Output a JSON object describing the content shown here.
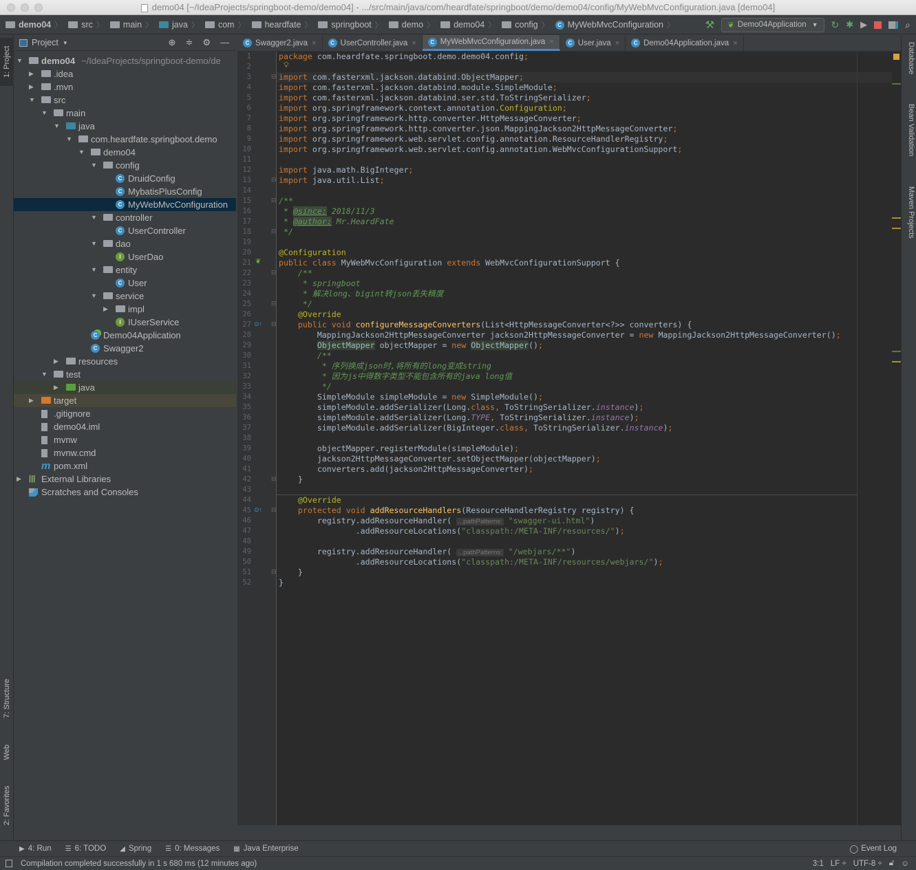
{
  "window": {
    "title": "demo04 [~/IdeaProjects/springboot-demo/demo04] - .../src/main/java/com/heardfate/springboot/demo/demo04/config/MyWebMvcConfiguration.java [demo04]"
  },
  "navbar": {
    "breadcrumbs": [
      "demo04",
      "src",
      "main",
      "java",
      "com",
      "heardfate",
      "springboot",
      "demo",
      "demo04",
      "config",
      "MyWebMvcConfiguration"
    ],
    "run_config": "Demo04Application"
  },
  "left_tool_tabs": [
    "1: Project",
    "7: Structure",
    "Web",
    "2: Favorites"
  ],
  "right_tool_tabs": [
    "Database",
    "Bean Validation",
    "Maven Projects"
  ],
  "project": {
    "header": "Project",
    "tree": [
      {
        "label": "demo04",
        "suffix": "~/IdeaProjects/springboot-demo/de",
        "depth": 0,
        "type": "module",
        "expanded": true
      },
      {
        "label": ".idea",
        "depth": 1,
        "type": "folder",
        "expanded": false
      },
      {
        "label": ".mvn",
        "depth": 1,
        "type": "folder",
        "expanded": false
      },
      {
        "label": "src",
        "depth": 1,
        "type": "folder",
        "expanded": true
      },
      {
        "label": "main",
        "depth": 2,
        "type": "folder",
        "expanded": true
      },
      {
        "label": "java",
        "depth": 3,
        "type": "source-folder",
        "expanded": true
      },
      {
        "label": "com.heardfate.springboot.demo",
        "depth": 4,
        "type": "package",
        "expanded": true
      },
      {
        "label": "demo04",
        "depth": 5,
        "type": "package",
        "expanded": true
      },
      {
        "label": "config",
        "depth": 6,
        "type": "package",
        "expanded": true
      },
      {
        "label": "DruidConfig",
        "depth": 7,
        "type": "class"
      },
      {
        "label": "MybatisPlusConfig",
        "depth": 7,
        "type": "class"
      },
      {
        "label": "MyWebMvcConfiguration",
        "depth": 7,
        "type": "class",
        "selected": true
      },
      {
        "label": "controller",
        "depth": 6,
        "type": "package",
        "expanded": true
      },
      {
        "label": "UserController",
        "depth": 7,
        "type": "class"
      },
      {
        "label": "dao",
        "depth": 6,
        "type": "package",
        "expanded": true
      },
      {
        "label": "UserDao",
        "depth": 7,
        "type": "interface"
      },
      {
        "label": "entity",
        "depth": 6,
        "type": "package",
        "expanded": true
      },
      {
        "label": "User",
        "depth": 7,
        "type": "class"
      },
      {
        "label": "service",
        "depth": 6,
        "type": "package",
        "expanded": true
      },
      {
        "label": "impl",
        "depth": 7,
        "type": "package",
        "expanded": false
      },
      {
        "label": "IUserService",
        "depth": 7,
        "type": "interface"
      },
      {
        "label": "Demo04Application",
        "depth": 5,
        "type": "spring-class"
      },
      {
        "label": "Swagger2",
        "depth": 5,
        "type": "class"
      },
      {
        "label": "resources",
        "depth": 3,
        "type": "resources-folder",
        "expanded": false
      },
      {
        "label": "test",
        "depth": 2,
        "type": "folder",
        "expanded": true
      },
      {
        "label": "java",
        "depth": 3,
        "type": "test-folder",
        "expanded": false,
        "highlight": "test"
      },
      {
        "label": "target",
        "depth": 1,
        "type": "excluded-folder",
        "expanded": false,
        "highlight": "excluded"
      },
      {
        "label": ".gitignore",
        "depth": 1,
        "type": "file"
      },
      {
        "label": "demo04.iml",
        "depth": 1,
        "type": "file"
      },
      {
        "label": "mvnw",
        "depth": 1,
        "type": "file"
      },
      {
        "label": "mvnw.cmd",
        "depth": 1,
        "type": "file"
      },
      {
        "label": "pom.xml",
        "depth": 1,
        "type": "maven"
      },
      {
        "label": "External Libraries",
        "depth": 0,
        "type": "libraries",
        "expanded": false
      },
      {
        "label": "Scratches and Consoles",
        "depth": 0,
        "type": "scratches"
      }
    ]
  },
  "editor": {
    "tabs": [
      {
        "label": "Swagger2.java",
        "icon": "class"
      },
      {
        "label": "UserController.java",
        "icon": "class"
      },
      {
        "label": "MyWebMvcConfiguration.java",
        "icon": "class",
        "active": true
      },
      {
        "label": "User.java",
        "icon": "class"
      },
      {
        "label": "Demo04Application.java",
        "icon": "spring-class"
      }
    ],
    "caret_line": 3,
    "lines": [
      [
        [
          "k",
          "package"
        ],
        [
          "t",
          " com.heardfate.springboot.demo.demo04.config"
        ],
        [
          "k",
          ";"
        ]
      ],
      [],
      [
        [
          "k",
          "import"
        ],
        [
          "t",
          " com.fasterxml.jackson.databind.ObjectMapper"
        ],
        [
          "k",
          ";"
        ]
      ],
      [
        [
          "k",
          "import"
        ],
        [
          "t",
          " com.fasterxml.jackson.databind.module.SimpleModule"
        ],
        [
          "k",
          ";"
        ]
      ],
      [
        [
          "k",
          "import"
        ],
        [
          "t",
          " com.fasterxml.jackson.databind.ser.std.ToStringSerializer"
        ],
        [
          "k",
          ";"
        ]
      ],
      [
        [
          "k",
          "import"
        ],
        [
          "t",
          " org.springframework.context.annotation."
        ],
        [
          "y",
          "Configuration"
        ],
        [
          "k",
          ";"
        ]
      ],
      [
        [
          "k",
          "import"
        ],
        [
          "t",
          " org.springframework.http.converter.HttpMessageConverter"
        ],
        [
          "k",
          ";"
        ]
      ],
      [
        [
          "k",
          "import"
        ],
        [
          "t",
          " org.springframework.http.converter.json.MappingJackson2HttpMessageConverter"
        ],
        [
          "k",
          ";"
        ]
      ],
      [
        [
          "k",
          "import"
        ],
        [
          "t",
          " org.springframework.web.servlet.config.annotation.ResourceHandlerRegistry"
        ],
        [
          "k",
          ";"
        ]
      ],
      [
        [
          "k",
          "import"
        ],
        [
          "t",
          " org.springframework.web.servlet.config.annotation.WebMvcConfigurationSupport"
        ],
        [
          "k",
          ";"
        ]
      ],
      [],
      [
        [
          "k",
          "import"
        ],
        [
          "t",
          " java.math.BigInteger"
        ],
        [
          "k",
          ";"
        ]
      ],
      [
        [
          "k",
          "import"
        ],
        [
          "t",
          " java.util.List"
        ],
        [
          "k",
          ";"
        ]
      ],
      [],
      [
        [
          "c",
          "/**"
        ]
      ],
      [
        [
          "c",
          " * "
        ],
        [
          "ct",
          "@since:"
        ],
        [
          "c",
          " 2018/11/3"
        ]
      ],
      [
        [
          "c",
          " * "
        ],
        [
          "ct",
          "@author:"
        ],
        [
          "c",
          " Mr.HeardFate"
        ]
      ],
      [
        [
          "c",
          " */"
        ]
      ],
      [],
      [
        [
          "a",
          "@Configuration"
        ]
      ],
      [
        [
          "k",
          "public class "
        ],
        [
          "t",
          "MyWebMvcConfiguration "
        ],
        [
          "k",
          "extends "
        ],
        [
          "t",
          "WebMvcConfigurationSupport {"
        ]
      ],
      [
        [
          "c",
          "    /**"
        ]
      ],
      [
        [
          "c",
          "     * springboot"
        ]
      ],
      [
        [
          "c",
          "     * 解决long、bigint转json丢失精度"
        ]
      ],
      [
        [
          "c",
          "     */"
        ]
      ],
      [
        [
          "a",
          "    @Override"
        ]
      ],
      [
        [
          "k",
          "    public void "
        ],
        [
          "m",
          "configureMessageConverters"
        ],
        [
          "t",
          "(List<HttpMessageConverter<?>> converters) {"
        ]
      ],
      [
        [
          "t",
          "        MappingJackson2HttpMessageConverter jackson2HttpMessageConverter = "
        ],
        [
          "k",
          "new "
        ],
        [
          "t",
          "MappingJackson2HttpMessageConverter()"
        ],
        [
          "k",
          ";"
        ]
      ],
      [
        [
          "t",
          "        "
        ],
        [
          "hl",
          "ObjectMapper"
        ],
        [
          "t",
          " objectMapper = "
        ],
        [
          "k",
          "new "
        ],
        [
          "hl",
          "ObjectMapper"
        ],
        [
          "t",
          "()"
        ],
        [
          "k",
          ";"
        ]
      ],
      [
        [
          "t",
          "        "
        ],
        [
          "c",
          "/**"
        ]
      ],
      [
        [
          "c",
          "         * 序列换成json时,将所有的long变成string"
        ]
      ],
      [
        [
          "c",
          "         * 因为js中得数字类型不能包含所有的java long值"
        ]
      ],
      [
        [
          "c",
          "         */"
        ]
      ],
      [
        [
          "t",
          "        SimpleModule simpleModule = "
        ],
        [
          "k",
          "new "
        ],
        [
          "t",
          "SimpleModule()"
        ],
        [
          "k",
          ";"
        ]
      ],
      [
        [
          "t",
          "        simpleModule.addSerializer(Long."
        ],
        [
          "k",
          "class, "
        ],
        [
          "t",
          "ToStringSerializer."
        ],
        [
          "f",
          "instance"
        ],
        [
          "t",
          ")"
        ],
        [
          "k",
          ";"
        ]
      ],
      [
        [
          "t",
          "        simpleModule.addSerializer(Long."
        ],
        [
          "f",
          "TYPE"
        ],
        [
          "k",
          ", "
        ],
        [
          "t",
          "ToStringSerializer."
        ],
        [
          "f",
          "instance"
        ],
        [
          "t",
          ")"
        ],
        [
          "k",
          ";"
        ]
      ],
      [
        [
          "t",
          "        simpleModule.addSerializer(BigInteger."
        ],
        [
          "k",
          "class, "
        ],
        [
          "t",
          "ToStringSerializer."
        ],
        [
          "f",
          "instance"
        ],
        [
          "t",
          ")"
        ],
        [
          "k",
          ";"
        ]
      ],
      [],
      [
        [
          "t",
          "        objectMapper.registerModule(simpleModule)"
        ],
        [
          "k",
          ";"
        ]
      ],
      [
        [
          "t",
          "        jackson2HttpMessageConverter.setObjectMapper(objectMapper)"
        ],
        [
          "k",
          ";"
        ]
      ],
      [
        [
          "t",
          "        converters.add(jackson2HttpMessageConverter)"
        ],
        [
          "k",
          ";"
        ]
      ],
      [
        [
          "t",
          "    }"
        ]
      ],
      [],
      [
        [
          "a",
          "    @Override"
        ]
      ],
      [
        [
          "k",
          "    protected void "
        ],
        [
          "m",
          "addResourceHandlers"
        ],
        [
          "t",
          "(ResourceHandlerRegistry registry) {"
        ]
      ],
      [
        [
          "t",
          "        registry.addResourceHandler( "
        ],
        [
          "h",
          "...pathPatterns:"
        ],
        [
          "s",
          " \"swagger-ui.html\""
        ],
        [
          "t",
          ")"
        ]
      ],
      [
        [
          "t",
          "                .addResourceLocations("
        ],
        [
          "s",
          "\"classpath:/META-INF/resources/\""
        ],
        [
          "t",
          ")"
        ],
        [
          "k",
          ";"
        ]
      ],
      [],
      [
        [
          "t",
          "        registry.addResourceHandler( "
        ],
        [
          "h",
          "...pathPatterns:"
        ],
        [
          "s",
          " \"/webjars/**\""
        ],
        [
          "t",
          ")"
        ]
      ],
      [
        [
          "t",
          "                .addResourceLocations("
        ],
        [
          "s",
          "\"classpath:/META-INF/resources/webjars/\""
        ],
        [
          "t",
          ")"
        ],
        [
          "k",
          ";"
        ]
      ],
      [
        [
          "t",
          "    }"
        ]
      ],
      [
        [
          "t",
          "}"
        ]
      ]
    ]
  },
  "bottom_tools": [
    {
      "label": "4: Run",
      "icon": "run-icon"
    },
    {
      "label": "6: TODO",
      "icon": "todo-icon"
    },
    {
      "label": "Spring",
      "icon": "spring-icon"
    },
    {
      "label": "0: Messages",
      "icon": "messages-icon"
    },
    {
      "label": "Java Enterprise",
      "icon": "java-enterprise-icon"
    }
  ],
  "event_log": "Event Log",
  "status": {
    "message": "Compilation completed successfully in 1 s 680 ms (12 minutes ago)",
    "position": "3:1",
    "line_sep": "LF ÷",
    "encoding": "UTF-8 ÷"
  },
  "colors": {
    "keyword": "#cc7832",
    "annotation": "#bbb529",
    "comment": "#629755",
    "string": "#6a8759",
    "method": "#ffc66d",
    "field": "#9876aa",
    "selection": "#0d293e",
    "accent": "#4a88c7"
  }
}
